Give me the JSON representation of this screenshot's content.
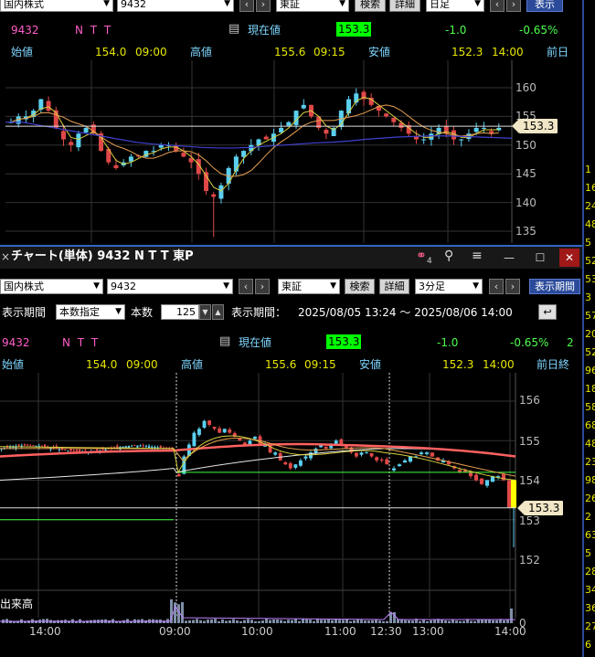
{
  "top": {
    "market_select": "国内株式",
    "code_field": "9432",
    "exchange_select": "東証",
    "search_button": "検索",
    "detail_button": "詳細",
    "period_select": "日足",
    "display_button": "表示",
    "code": "9432",
    "name": "N T T",
    "current_label": "現在値",
    "price": "153.3",
    "change": "-1.0",
    "change_pct": "-0.65%",
    "open_label": "始値",
    "open_value": "154.0",
    "open_time": "09:00",
    "high_label": "高値",
    "high_value": "155.6",
    "high_time": "09:15",
    "low_label": "安値",
    "low_value": "152.3",
    "low_time": "14:00",
    "prev_label": "前日",
    "price_tag": "153.3",
    "y_ticks": [
      "160",
      "155",
      "150",
      "145",
      "140",
      "135"
    ]
  },
  "window": {
    "title": "チャート(単体) 9432 N T T 東P",
    "link_badge": "4"
  },
  "bottom": {
    "market_select": "国内株式",
    "code_field": "9432",
    "exchange_select": "東証",
    "search_button": "検索",
    "detail_button": "詳細",
    "period_select": "3分足",
    "display_button": "表示期間",
    "period_label": "表示期間",
    "mode_select": "本数指定",
    "count_label": "本数",
    "count_value": "125",
    "range_label": "表示期間：",
    "range_value": "2025/08/05 13:24 ～ 2025/08/06 14:00",
    "code": "9432",
    "name": "N T T",
    "current_label": "現在値",
    "price": "153.3",
    "change": "-1.0",
    "change_pct": "-0.65%",
    "extra": "2",
    "open_label": "始値",
    "open_value": "154.0",
    "open_time": "09:00",
    "high_label": "高値",
    "high_value": "155.6",
    "high_time": "09:15",
    "low_label": "安値",
    "low_value": "152.3",
    "low_time": "14:00",
    "prev_label": "前日終",
    "price_tag": "153.3",
    "volume_label": "出来高",
    "volume_zero": "0",
    "y_ticks": [
      "156",
      "155",
      "154",
      "153",
      "152"
    ],
    "x_ticks": [
      "14:00",
      "09:00",
      "10:00",
      "11:00",
      "12:30",
      "13:00",
      "14:00"
    ]
  },
  "right_column": [
    "1",
    "16",
    "24",
    "48",
    "5",
    "52",
    "53",
    "3",
    "57",
    "20",
    "52",
    "96",
    "18",
    "58",
    "68",
    "48",
    "23",
    "98",
    "26",
    "2",
    "63",
    "5",
    "28",
    "34",
    "36",
    "27",
    "6"
  ],
  "colors": {
    "up": "#5bd0f0",
    "down": "#e04848",
    "ma_fast": "#e8a050",
    "ma_mid": "#d8d040",
    "ma_slow": "#4040d0",
    "ma_white": "#e8e8e8",
    "vwap": "#ff6060",
    "green_line": "#40ff40",
    "current_bar": "#ffff00",
    "accent": "#00ff00"
  }
}
